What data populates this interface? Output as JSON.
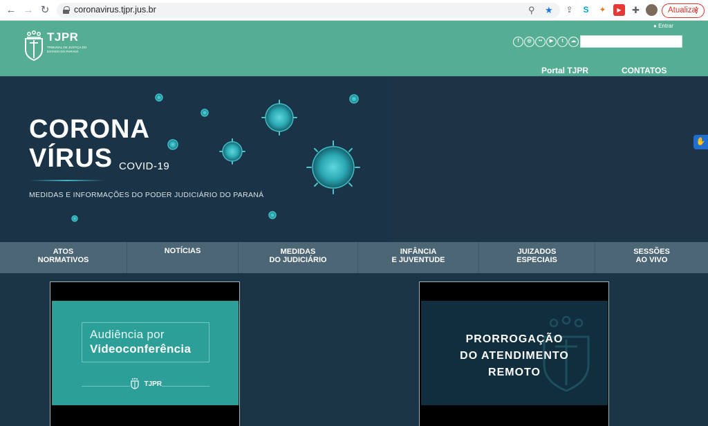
{
  "browser": {
    "url": "coronavirus.tjpr.jus.br",
    "update_label": "Atualizar",
    "update_dots": "⋮",
    "back_glyph": "←",
    "forward_glyph": "→",
    "reload_glyph": "↻",
    "accent": "#d93025"
  },
  "header": {
    "logo_text": "TJPR",
    "logo_subtitle": "TRIBUNAL DE JUSTIÇA DO ESTADO DO PARANÁ",
    "login_label": "Entrar",
    "social_icons": [
      "facebook-icon",
      "instagram-icon",
      "flickr-icon",
      "youtube-icon",
      "twitter-icon",
      "soundcloud-icon"
    ],
    "social_glyphs": [
      "f",
      "◎",
      "••",
      "▶",
      "t",
      "☁"
    ],
    "search_placeholder": "",
    "nav": [
      "Portal TJPR",
      "CONTATOS"
    ],
    "background": "#55ae94"
  },
  "hero": {
    "title_line1": "CORONA",
    "title_line2": "VÍRUS",
    "tag": "COVID-19",
    "subtitle": "MEDIDAS E INFORMAÇÕES DO PODER JUDICIÁRIO DO PARANÁ"
  },
  "menu": [
    {
      "label": "ATOS\nNORMATIVOS"
    },
    {
      "label": "NOTÍCIAS"
    },
    {
      "label": "MEDIDAS\nDO JUDICIÁRIO"
    },
    {
      "label": "INFÂNCIA\nE JUVENTUDE"
    },
    {
      "label": "JUIZADOS\nESPECIAIS"
    },
    {
      "label": "SESSÕES\nAO VIVO"
    }
  ],
  "cards": {
    "video_conf": {
      "line1": "Audiência por",
      "line2": "Videoconferência",
      "logo": "TJPR"
    },
    "remote": {
      "line1": "PRORROGAÇÃO",
      "line2": "DO ATENDIMENTO",
      "line3": "REMOTO"
    }
  }
}
